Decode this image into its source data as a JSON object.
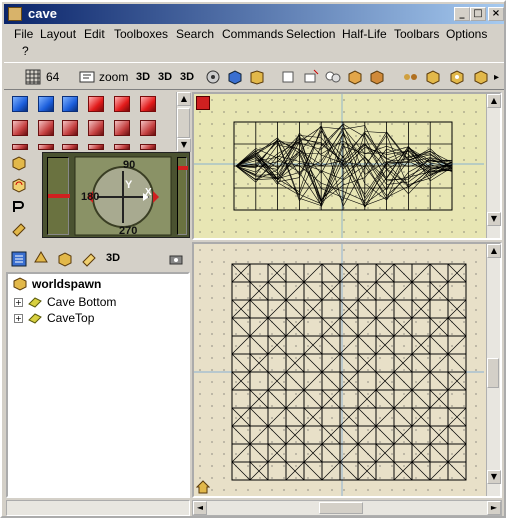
{
  "window": {
    "title": "cave"
  },
  "menu": {
    "items": [
      "File",
      "Layout",
      "Edit",
      "Toolboxes",
      "Search",
      "Commands",
      "Selection",
      "Half-Life",
      "Toolbars",
      "Options"
    ],
    "help": "?"
  },
  "toolbar": {
    "grid_value": "64",
    "zoom_label": "zoom",
    "mode_3d_a": "3D",
    "mode_3d_b": "3D",
    "mode_3d_c": "3D"
  },
  "compass": {
    "n": "90",
    "w": "180",
    "s": "270",
    "axis_y": "Y",
    "axis_x": "X"
  },
  "entity_tabs": {
    "mode_3d": "3D"
  },
  "tree": {
    "root": "worldspawn",
    "children": [
      "Cave Bottom",
      "CaveTop"
    ]
  },
  "colors": {
    "title_start": "#0a246a",
    "title_end": "#a6caf0",
    "view_top_bg": "#e8e6b4",
    "view_bottom_bg": "#e8e0c8",
    "wire": "#000000",
    "axis": "#6aa0d8"
  }
}
